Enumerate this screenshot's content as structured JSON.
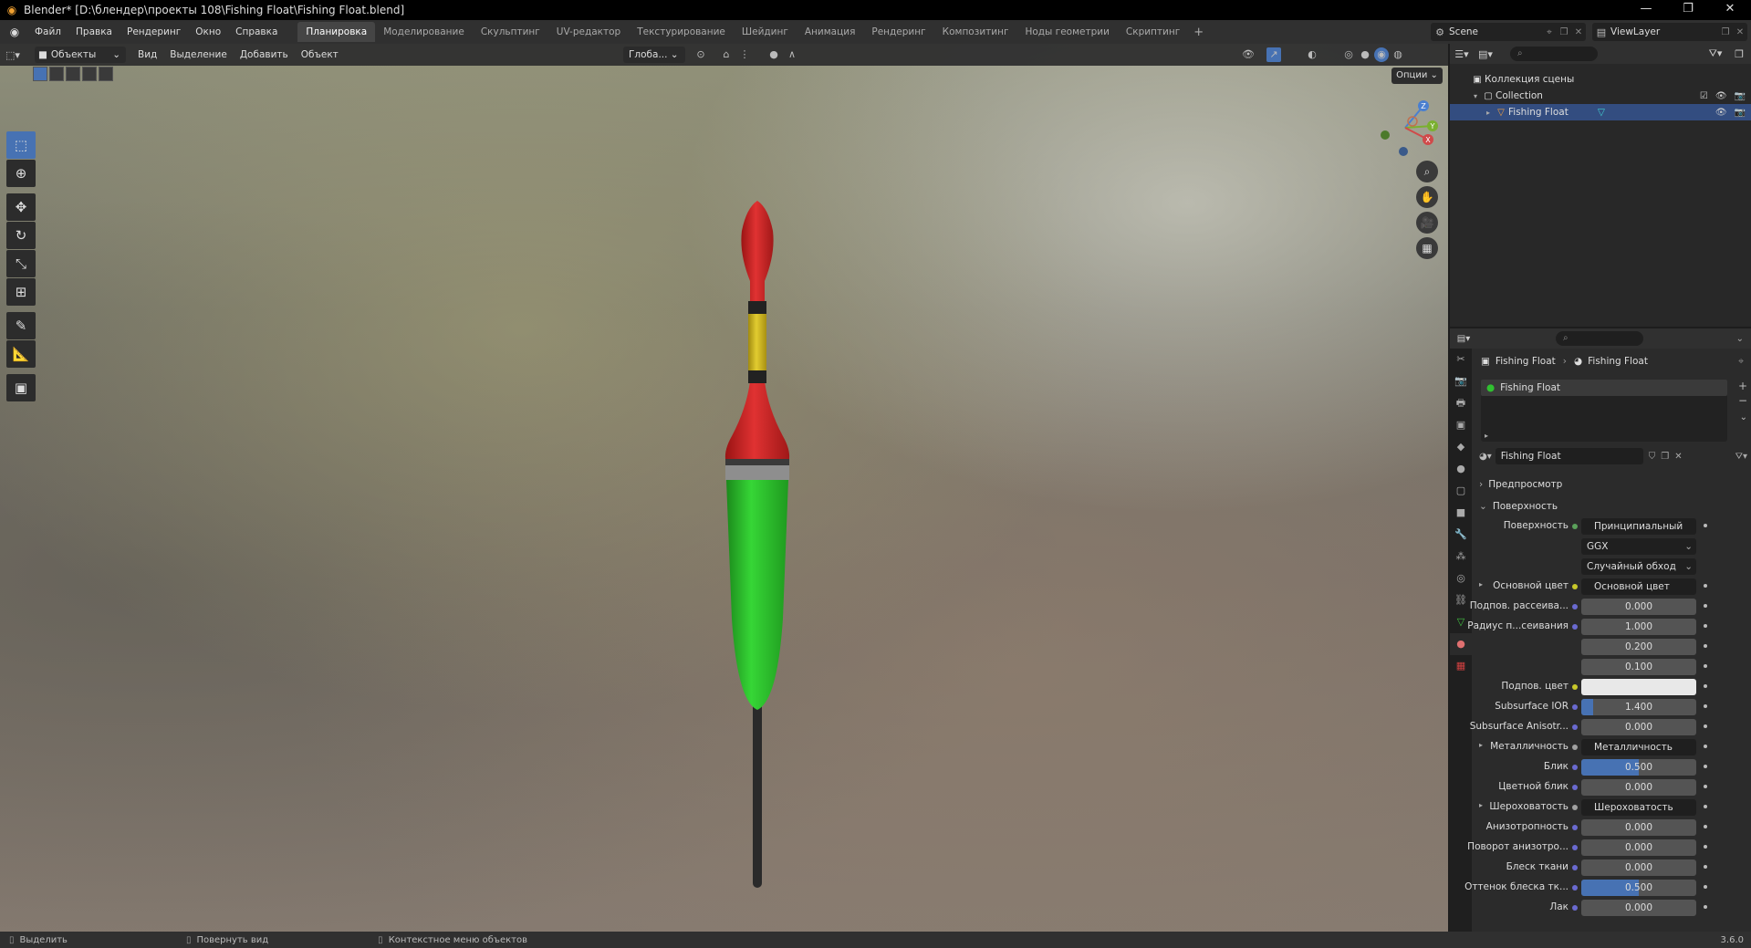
{
  "window": {
    "title": "Blender* [D:\\блендер\\проекты 108\\Fishing Float\\Fishing Float.blend]",
    "controls": [
      "—",
      "❐",
      "✕"
    ]
  },
  "menu": [
    "Файл",
    "Правка",
    "Рендеринг",
    "Окно",
    "Справка"
  ],
  "workspaces": [
    {
      "label": "Планировка",
      "active": true
    },
    {
      "label": "Моделирование"
    },
    {
      "label": "Скульптинг"
    },
    {
      "label": "UV-редактор"
    },
    {
      "label": "Текстурирование"
    },
    {
      "label": "Шейдинг"
    },
    {
      "label": "Анимация"
    },
    {
      "label": "Рендеринг"
    },
    {
      "label": "Композитинг"
    },
    {
      "label": "Ноды геометрии"
    },
    {
      "label": "Скриптинг"
    }
  ],
  "scene": {
    "name": "Scene",
    "view_layer": "ViewLayer"
  },
  "viewport": {
    "mode": "Объекты",
    "menu": [
      "Вид",
      "Выделение",
      "Добавить",
      "Объект"
    ],
    "orientation": "Глоба...",
    "options_label": "Опции",
    "gizmo_axes": [
      "Z",
      "Y",
      "X"
    ]
  },
  "outliner": {
    "root": "Коллекция сцены",
    "collection": "Collection",
    "object": "Fishing Float"
  },
  "properties": {
    "breadcrumb_object": "Fishing Float",
    "breadcrumb_material": "Fishing Float",
    "slot": "Fishing Float",
    "material_name": "Fishing Float",
    "panel_preview": "Предпросмотр",
    "panel_surface": "Поверхность",
    "rows": [
      {
        "label": "Поверхность",
        "value": "Принципиальный BSDF",
        "kind": "link",
        "sock": "g"
      },
      {
        "label": "",
        "value": "GGX",
        "kind": "dd"
      },
      {
        "label": "",
        "value": "Случайный обход",
        "kind": "dd"
      },
      {
        "label": "Основной цвет",
        "value": "Основной цвет",
        "kind": "link",
        "sock": "y",
        "tri": true
      },
      {
        "label": "Подпов. рассеива...",
        "value": "0.000",
        "kind": "num",
        "fill": 0
      },
      {
        "label": "Радиус п...сеивания",
        "value": "1.000",
        "kind": "num",
        "fill": 0,
        "sock": "b"
      },
      {
        "label": "",
        "value": "0.200",
        "kind": "num",
        "fill": 0,
        "nosock": true
      },
      {
        "label": "",
        "value": "0.100",
        "kind": "num",
        "fill": 0,
        "nosock": true
      },
      {
        "label": "Подпов. цвет",
        "value": "",
        "kind": "white",
        "sock": "y"
      },
      {
        "label": "Subsurface IOR",
        "value": "1.400",
        "kind": "num",
        "fill": 0.1
      },
      {
        "label": "Subsurface Anisotr...",
        "value": "0.000",
        "kind": "num",
        "fill": 0
      },
      {
        "label": "Металличность",
        "value": "Металличность",
        "kind": "link",
        "sock": "gr",
        "tri": true
      },
      {
        "label": "Блик",
        "value": "0.500",
        "kind": "num",
        "fill": 0.5
      },
      {
        "label": "Цветной блик",
        "value": "0.000",
        "kind": "num",
        "fill": 0
      },
      {
        "label": "Шероховатость",
        "value": "Шероховатость",
        "kind": "link",
        "sock": "gr",
        "tri": true
      },
      {
        "label": "Анизотропность",
        "value": "0.000",
        "kind": "num",
        "fill": 0
      },
      {
        "label": "Поворот анизотро...",
        "value": "0.000",
        "kind": "num",
        "fill": 0
      },
      {
        "label": "Блеск ткани",
        "value": "0.000",
        "kind": "num",
        "fill": 0
      },
      {
        "label": "Оттенок блеска тк...",
        "value": "0.500",
        "kind": "num",
        "fill": 0.5
      },
      {
        "label": "Лак",
        "value": "0.000",
        "kind": "num",
        "fill": 0
      }
    ]
  },
  "statusbar": {
    "items": [
      "Выделить",
      "Повернуть вид",
      "Контекстное меню объектов"
    ],
    "version": "3.6.0"
  },
  "colors": {
    "accent": "#4772b3",
    "float_red": "#d42a2a",
    "float_green": "#2ec52e",
    "float_yellow": "#d8c024"
  }
}
